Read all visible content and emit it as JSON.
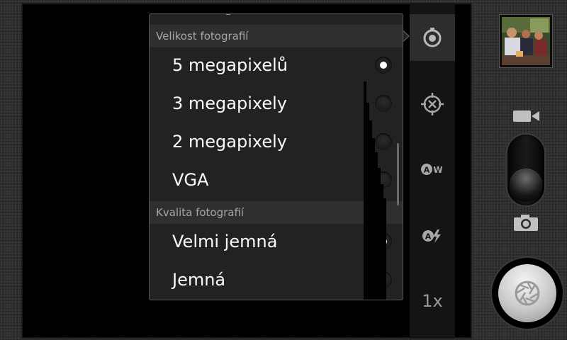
{
  "settings_popup": {
    "sections": [
      {
        "header": "Velikost fotografií",
        "options": [
          {
            "label": "5 megapixelů",
            "selected": true
          },
          {
            "label": "3 megapixely",
            "selected": false
          },
          {
            "label": "2 megapixely",
            "selected": false
          },
          {
            "label": "VGA",
            "selected": false
          }
        ]
      },
      {
        "header": "Kvalita fotografií",
        "options": [
          {
            "label": "Velmi jemná",
            "selected": true
          },
          {
            "label": "Jemná",
            "selected": false
          }
        ]
      }
    ]
  },
  "control_strip": {
    "zoom_label": "1x",
    "icons": [
      "settings-icon",
      "focus-target-icon",
      "white-balance-auto-icon",
      "flash-auto-icon"
    ]
  },
  "camera_controls": {
    "mode": "photo",
    "icons": [
      "video-icon",
      "camera-icon",
      "shutter-icon"
    ]
  }
}
